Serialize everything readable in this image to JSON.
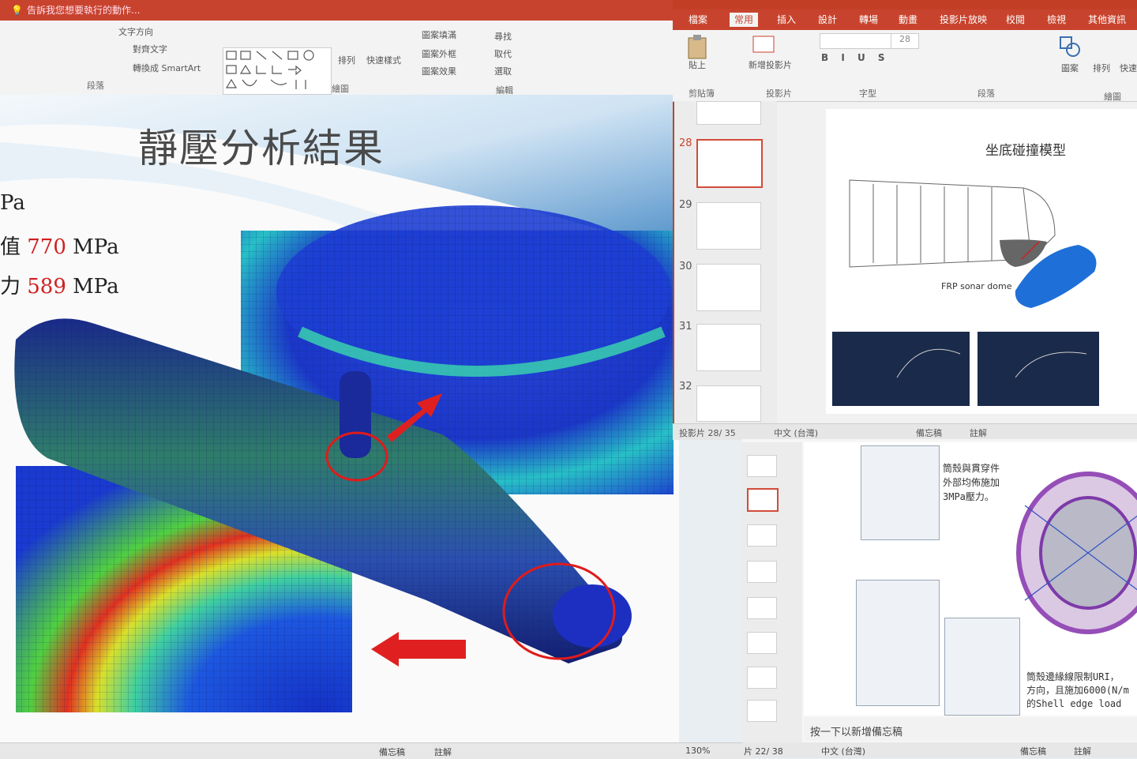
{
  "left_window": {
    "tellme": "告訴我您想要執行的動作...",
    "ribbon": {
      "text_direction": "文字方向",
      "align_text": "對齊文字",
      "convert_smartart": "轉換成 SmartArt",
      "paragraph_group": "段落",
      "arrange": "排列",
      "quick_styles": "快速樣式",
      "shape_fill": "圖案填滿",
      "shape_outline": "圖案外框",
      "shape_effects": "圖案效果",
      "drawing_group": "繪圖",
      "find": "尋找",
      "replace": "取代",
      "select": "選取",
      "editing_group": "編輯"
    },
    "slide": {
      "title": "靜壓分析結果",
      "lines": [
        {
          "prefix": "Pa",
          "value": "",
          "unit": ""
        },
        {
          "prefix": "值 ",
          "value": "770",
          "unit": " MPa"
        },
        {
          "prefix": "力 ",
          "value": "589",
          "unit": " MPa"
        }
      ]
    },
    "status": {
      "notes": "備忘稿",
      "comments": "註解",
      "zoom": "130%"
    }
  },
  "right_window": {
    "tabs": [
      "檔案",
      "常用",
      "插入",
      "設計",
      "轉場",
      "動畫",
      "投影片放映",
      "校閱",
      "檢視",
      "其他資訊"
    ],
    "active_tab": "常用",
    "ribbon": {
      "paste": "貼上",
      "clipboard_group": "剪貼簿",
      "new_slide": "新增投影片",
      "slides_group": "投影片",
      "font_group": "字型",
      "font_size": "28",
      "paragraph_group": "段落",
      "shapes": "圖案",
      "arrange": "排列",
      "quick": "快速",
      "drawing_group": "繪圖"
    },
    "thumbnails": [
      {
        "num": "28",
        "selected": true
      },
      {
        "num": "29",
        "selected": false
      },
      {
        "num": "30",
        "selected": false
      },
      {
        "num": "31",
        "selected": false
      },
      {
        "num": "32",
        "selected": false
      }
    ],
    "slide": {
      "title": "坐底碰撞模型",
      "label": "FRP sonar dome"
    },
    "status": {
      "slide_counter": "投影片 28/ 35",
      "language": "中文 (台灣)",
      "notes": "備忘稿",
      "comments": "註解"
    }
  },
  "lower_window": {
    "slide": {
      "text1": [
        "筒殼與貫穿件",
        "外部均佈施加",
        "3MPa壓力。"
      ],
      "text2": [
        "筒殼邊緣線限制URI，",
        "方向，且施加6000(N/m",
        "的Shell edge load"
      ]
    },
    "notes_placeholder": "按一下以新增備忘稿",
    "status": {
      "slide_counter": "片 22/ 38",
      "language": "中文 (台灣)",
      "notes": "備忘稿",
      "comments": "註解"
    }
  },
  "colors": {
    "accent": "#c8432d",
    "highlight_red": "#d02020",
    "fem_blue": "#1a3fd0",
    "fem_green": "#2fd080"
  }
}
